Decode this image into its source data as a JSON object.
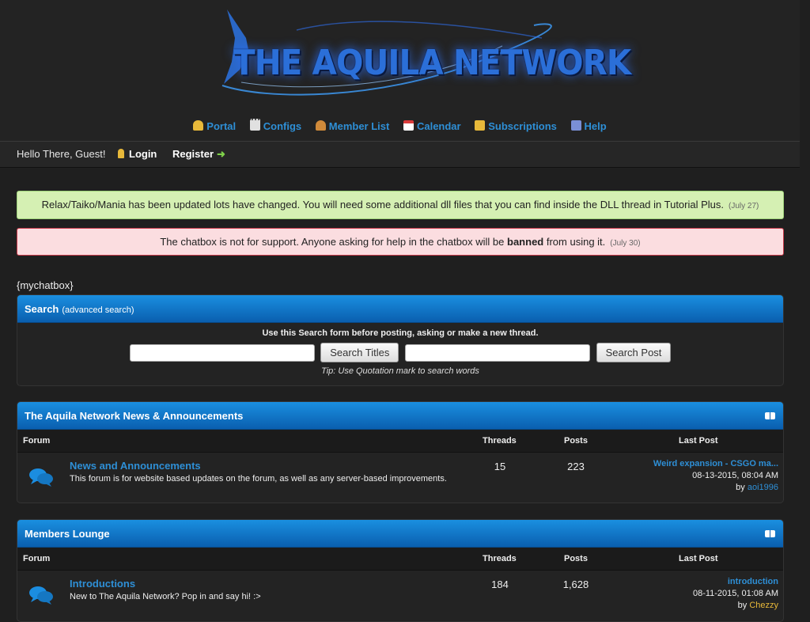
{
  "header": {
    "logo_text": "THE AQUILA NETWORK",
    "nav": [
      {
        "label": "Portal",
        "icon": "bell-icon",
        "color": "#e8b93a"
      },
      {
        "label": "Configs",
        "icon": "notepad-icon",
        "color": "#e0e0e0"
      },
      {
        "label": "Member List",
        "icon": "users-icon",
        "color": "#d08a3a"
      },
      {
        "label": "Calendar",
        "icon": "calendar-icon",
        "color": "#d93b3b"
      },
      {
        "label": "Subscriptions",
        "icon": "subscriptions-icon",
        "color": "#e8b93a"
      },
      {
        "label": "Help",
        "icon": "help-icon",
        "color": "#7a8fd6"
      }
    ]
  },
  "userbar": {
    "greeting": "Hello There, Guest!",
    "login": "Login",
    "register": "Register"
  },
  "announcements": [
    {
      "text": "Relax/Taiko/Mania has been updated lots have changed. You will need some additional dll files that you can find inside the DLL thread in Tutorial Plus.",
      "date": "(July 27)"
    },
    {
      "text_before": "The chatbox is not for support. Anyone asking for help in the chatbox will be ",
      "text_bold": "banned",
      "text_after": " from using it.",
      "date": "(July 30)"
    }
  ],
  "chatbox_placeholder": "{mychatbox}",
  "search": {
    "title": "Search",
    "advanced": "(advanced search)",
    "instruction": "Use this Search form before posting, asking or make a new thread.",
    "titles_value": "",
    "posts_value": "",
    "btn_titles": "Search Titles",
    "btn_posts": "Search Post",
    "tip": "Tip: Use Quotation mark to search words"
  },
  "categories": [
    {
      "title": "The Aquila Network News & Announcements",
      "columns": {
        "forum": "Forum",
        "threads": "Threads",
        "posts": "Posts",
        "lastpost": "Last Post"
      },
      "forums": [
        {
          "name": "News and Announcements",
          "desc": "This forum is for website based updates on the forum, as well as any server-based improvements.",
          "threads": "15",
          "posts": "223",
          "last_thread": "Weird expansion - CSGO ma...",
          "last_date": "08-13-2015, 08:04 AM",
          "last_by": "by",
          "last_user": "aoi1996"
        }
      ]
    },
    {
      "title": "Members Lounge",
      "columns": {
        "forum": "Forum",
        "threads": "Threads",
        "posts": "Posts",
        "lastpost": "Last Post"
      },
      "forums": [
        {
          "name": "Introductions",
          "desc": "New to The Aquila Network? Pop in and say hi! :>",
          "threads": "184",
          "posts": "1,628",
          "last_thread": "introduction",
          "last_date": "08-11-2015, 01:08 AM",
          "last_by": "by",
          "last_user": "Chezzy"
        }
      ]
    }
  ],
  "colors": {
    "accent": "#2e8fd6",
    "panel_head": "#0a5faf",
    "success_bg": "#d5f0b3",
    "danger_bg": "#fbdde0"
  }
}
